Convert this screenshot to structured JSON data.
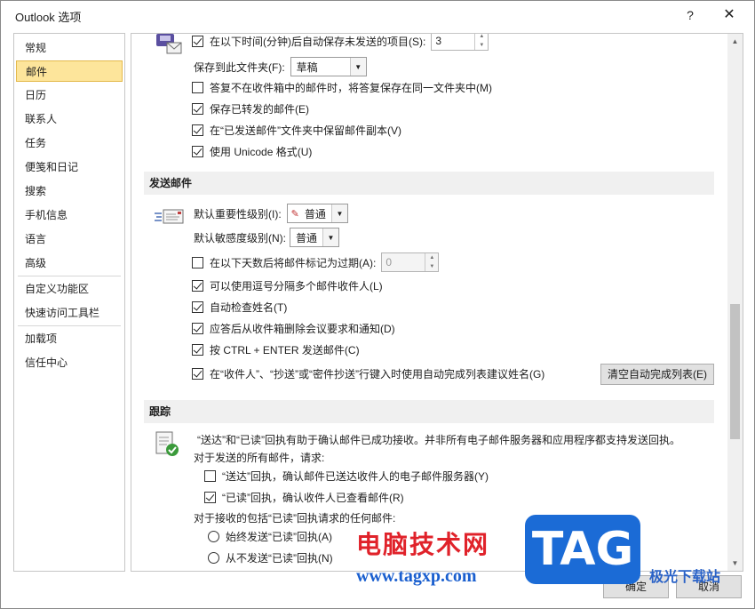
{
  "window": {
    "title": "Outlook 选项",
    "help_label": "?",
    "close_label": "✕"
  },
  "nav": {
    "items": [
      {
        "label": "常规"
      },
      {
        "label": "邮件",
        "active": true
      },
      {
        "label": "日历"
      },
      {
        "label": "联系人"
      },
      {
        "label": "任务"
      },
      {
        "label": "便笺和日记"
      },
      {
        "label": "搜索"
      },
      {
        "label": "手机信息"
      },
      {
        "label": "语言"
      },
      {
        "label": "高级"
      },
      {
        "label": "自定义功能区"
      },
      {
        "label": "快速访问工具栏"
      },
      {
        "label": "加载项"
      },
      {
        "label": "信任中心"
      }
    ]
  },
  "save_section": {
    "autosave_label": "在以下时间(分钟)后自动保存未发送的项目(S):",
    "autosave_value": "3",
    "save_to_folder_label": "保存到此文件夹(F):",
    "save_to_folder_value": "草稿",
    "options": [
      {
        "label": "答复不在收件箱中的邮件时，将答复保存在同一文件夹中(M)",
        "checked": false
      },
      {
        "label": "保存已转发的邮件(E)",
        "checked": true
      },
      {
        "label": "在“已发送邮件”文件夹中保留邮件副本(V)",
        "checked": true
      },
      {
        "label": "使用 Unicode 格式(U)",
        "checked": true
      }
    ]
  },
  "send_section": {
    "header": "发送邮件",
    "importance_label": "默认重要性级别(I):",
    "importance_value": "普通",
    "sensitivity_label": "默认敏感度级别(N):",
    "sensitivity_value": "普通",
    "expire_label": "在以下天数后将邮件标记为过期(A):",
    "expire_value": "0",
    "expire_checked": false,
    "options": [
      {
        "label": "可以使用逗号分隔多个邮件收件人(L)",
        "checked": true
      },
      {
        "label": "自动检查姓名(T)",
        "checked": true
      },
      {
        "label": "应答后从收件箱删除会议要求和通知(D)",
        "checked": true
      },
      {
        "label": "按 CTRL + ENTER 发送邮件(C)",
        "checked": true
      }
    ],
    "autocomplete_label": "在“收件人”、“抄送”或“密件抄送”行键入时使用自动完成列表建议姓名(G)",
    "autocomplete_checked": true,
    "clear_autocomplete_button": "清空自动完成列表(E)"
  },
  "tracking_section": {
    "header": "跟踪",
    "description": "“送达”和“已读”回执有助于确认邮件已成功接收。并非所有电子邮件服务器和应用程序都支持发送回执。",
    "all_sent_label": "对于发送的所有邮件，请求:",
    "delivery_receipt": {
      "label": "“送达”回执，确认邮件已送达收件人的电子邮件服务器(Y)",
      "checked": false
    },
    "read_receipt": {
      "label": "“已读”回执，确认收件人已查看邮件(R)",
      "checked": true
    },
    "received_label": "对于接收的包括“已读”回执请求的任何邮件:",
    "radio_always": "始终发送“已读”回执(A)",
    "radio_never": "从不发送“已读”回执(N)"
  },
  "footer": {
    "ok_label": "确定",
    "cancel_label": "取消"
  },
  "watermark": {
    "cn_text": "电脑技术网",
    "url_text": "www.tagxp.com",
    "tag_text": "TAG",
    "site_text": "极光下载站"
  }
}
